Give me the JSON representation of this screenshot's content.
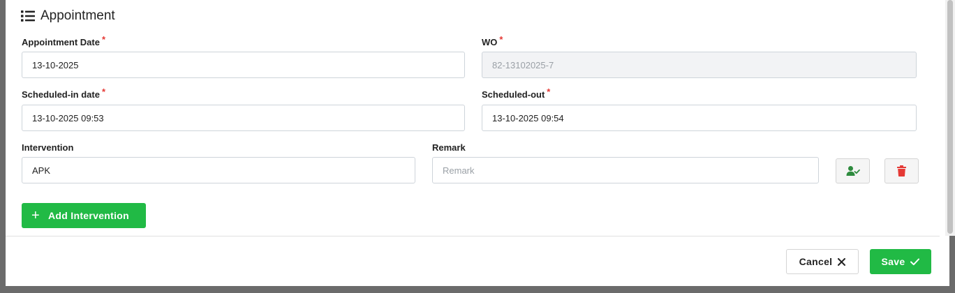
{
  "header": {
    "title": "Appointment",
    "icon": "list-icon"
  },
  "form": {
    "appointment_date": {
      "label": "Appointment Date",
      "required_mark": "*",
      "value": "13-10-2025"
    },
    "wo": {
      "label": "WO",
      "required_mark": "*",
      "value": "82-13102025-7"
    },
    "scheduled_in": {
      "label": "Scheduled-in date",
      "required_mark": "*",
      "value": "13-10-2025 09:53"
    },
    "scheduled_out": {
      "label": "Scheduled-out",
      "required_mark": "*",
      "value": "13-10-2025 09:54"
    },
    "intervention": {
      "label": "Intervention",
      "value": "APK"
    },
    "remark": {
      "label": "Remark",
      "value": "",
      "placeholder": "Remark"
    }
  },
  "row_actions": {
    "assign_icon": "user-check-icon",
    "delete_icon": "trash-icon"
  },
  "add_intervention": {
    "label": "Add Intervention",
    "icon": "plus-icon"
  },
  "footer": {
    "cancel_label": "Cancel",
    "save_label": "Save"
  },
  "colors": {
    "primary_green": "#21ba45",
    "danger_red": "#e53935",
    "required_red": "#e53935"
  }
}
